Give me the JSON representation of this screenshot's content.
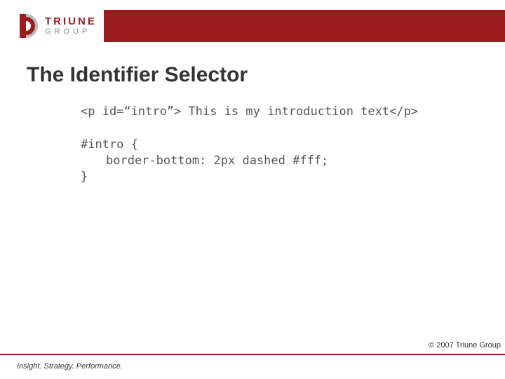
{
  "logo": {
    "line1": "TRIUNE",
    "line2": "GROUP"
  },
  "title": "The Identifier Selector",
  "code": {
    "html_example": "<p id=“intro”> This is my introduction text</p>",
    "css_open": "#intro {",
    "css_rule": "border-bottom: 2px dashed #fff;",
    "css_close": "}"
  },
  "copyright": "© 2007 Triune Group",
  "tagline": "Insight. Strategy. Performance."
}
